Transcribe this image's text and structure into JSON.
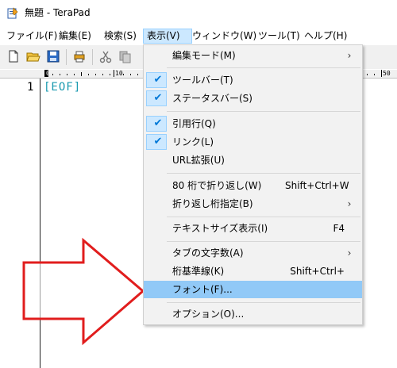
{
  "window": {
    "title": "無題 - TeraPad"
  },
  "menubar": {
    "items": [
      {
        "label": "ファイル(F)"
      },
      {
        "label": "編集(E)"
      },
      {
        "label": "検索(S)"
      },
      {
        "label": "表示(V)"
      },
      {
        "label": "ウィンドウ(W)"
      },
      {
        "label": "ツール(T)"
      },
      {
        "label": "ヘルプ(H)"
      }
    ]
  },
  "toolbar": {
    "icons": [
      "new-file-icon",
      "open-folder-icon",
      "save-icon",
      "print-icon",
      "cut-icon",
      "copy-icon"
    ]
  },
  "ruler": {
    "marks": [
      "0",
      "10",
      "50"
    ]
  },
  "editor": {
    "line_number": "1",
    "eof": "[EOF]"
  },
  "view_menu": {
    "items": [
      {
        "label": "編集モード(M)",
        "shortcut": "",
        "submenu": true,
        "checked": false
      },
      {
        "label": "ツールバー(T)",
        "shortcut": "",
        "submenu": false,
        "checked": true
      },
      {
        "label": "ステータスバー(S)",
        "shortcut": "",
        "submenu": false,
        "checked": true
      },
      {
        "label": "引用行(Q)",
        "shortcut": "",
        "submenu": false,
        "checked": true
      },
      {
        "label": "リンク(L)",
        "shortcut": "",
        "submenu": false,
        "checked": true
      },
      {
        "label": "URL拡張(U)",
        "shortcut": "",
        "submenu": false,
        "checked": false
      },
      {
        "label": "80 桁で折り返し(W)",
        "shortcut": "Shift+Ctrl+W",
        "submenu": false,
        "checked": false
      },
      {
        "label": "折り返し桁指定(B)",
        "shortcut": "",
        "submenu": true,
        "checked": false
      },
      {
        "label": "テキストサイズ表示(I)",
        "shortcut": "F4",
        "submenu": false,
        "checked": false
      },
      {
        "label": "タブの文字数(A)",
        "shortcut": "",
        "submenu": true,
        "checked": false
      },
      {
        "label": "桁基準線(K)",
        "shortcut": "Shift+Ctrl+¥",
        "submenu": false,
        "checked": false
      },
      {
        "label": "フォント(F)...",
        "shortcut": "",
        "submenu": false,
        "checked": false,
        "highlighted": true
      },
      {
        "label": "オプション(O)...",
        "shortcut": "",
        "submenu": false,
        "checked": false
      }
    ],
    "check_glyph": "✔",
    "submenu_glyph": "›"
  },
  "annotation": {
    "color": "#e11d1d"
  }
}
